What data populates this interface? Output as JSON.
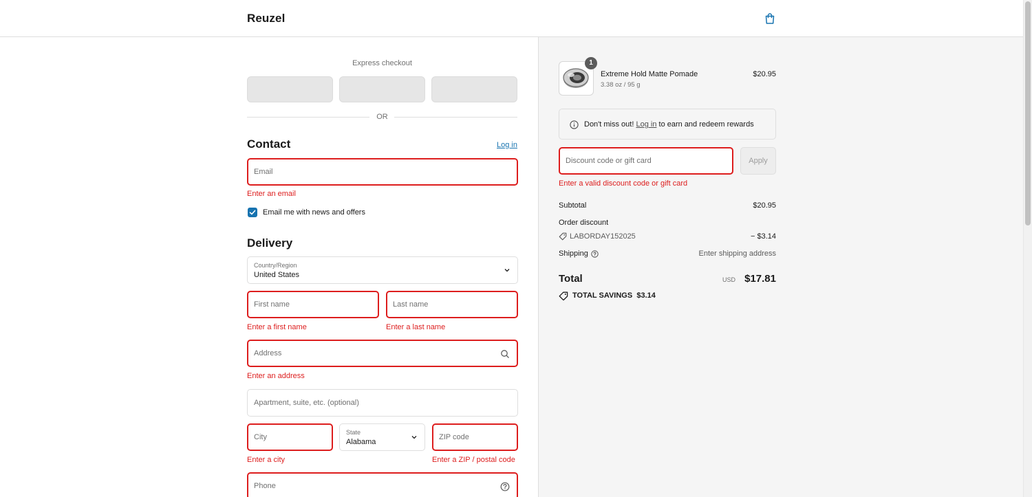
{
  "header": {
    "brand": "Reuzel",
    "cart_icon": "shopping-bag-icon"
  },
  "express": {
    "label": "Express checkout",
    "or": "OR"
  },
  "contact": {
    "title": "Contact",
    "login_link": "Log in",
    "email_placeholder": "Email",
    "email_error": "Enter an email",
    "newsletter_label": "Email me with news and offers",
    "newsletter_checked": true
  },
  "delivery": {
    "title": "Delivery",
    "country_label": "Country/Region",
    "country_value": "United States",
    "first_name_placeholder": "First name",
    "first_name_error": "Enter a first name",
    "last_name_placeholder": "Last name",
    "last_name_error": "Enter a last name",
    "address_placeholder": "Address",
    "address_error": "Enter an address",
    "apartment_placeholder": "Apartment, suite, etc. (optional)",
    "city_placeholder": "City",
    "city_error": "Enter a city",
    "state_label": "State",
    "state_value": "Alabama",
    "zip_placeholder": "ZIP code",
    "zip_error": "Enter a ZIP / postal code",
    "phone_placeholder": "Phone"
  },
  "order": {
    "item": {
      "quantity": "1",
      "name": "Extreme Hold Matte Pomade",
      "variant": "3.38 oz / 95 g",
      "price": "$20.95"
    },
    "rewards": {
      "prefix": "Don't miss out!",
      "link": "Log in",
      "suffix": "to earn and redeem rewards"
    },
    "discount_placeholder": "Discount code or gift card",
    "apply_label": "Apply",
    "discount_error": "Enter a valid discount code or gift card",
    "subtotal_label": "Subtotal",
    "subtotal_value": "$20.95",
    "order_discount_label": "Order discount",
    "discount_code": "LABORDAY152025",
    "discount_value": "− $3.14",
    "shipping_label": "Shipping",
    "shipping_value": "Enter shipping address",
    "total_label": "Total",
    "currency": "USD",
    "total_value": "$17.81",
    "savings_label": "TOTAL SAVINGS",
    "savings_value": "$3.14"
  },
  "colors": {
    "error": "#dd1d1d",
    "link": "#1773b0",
    "panel_bg": "#f5f5f5"
  }
}
